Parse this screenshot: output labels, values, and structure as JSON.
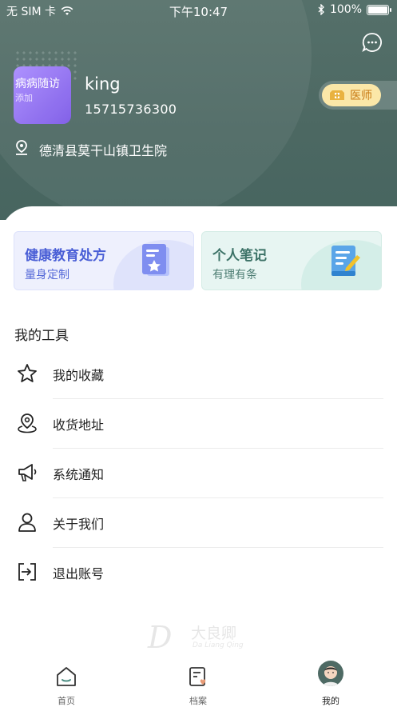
{
  "status_bar": {
    "carrier": "无 SIM 卡",
    "time": "下午10:47",
    "battery": "100%"
  },
  "profile": {
    "avatar_line1": "病病随访",
    "avatar_line2": "添加",
    "name": "king",
    "phone": "15715736300",
    "badge": "医师",
    "hospital": "德清县莫干山镇卫生院"
  },
  "cards": [
    {
      "title": "健康教育处方",
      "subtitle": "量身定制"
    },
    {
      "title": "个人笔记",
      "subtitle": "有理有条"
    }
  ],
  "tools": {
    "title": "我的工具",
    "items": [
      {
        "label": "我的收藏",
        "icon": "star-icon"
      },
      {
        "label": "收货地址",
        "icon": "location-icon"
      },
      {
        "label": "系统通知",
        "icon": "megaphone-icon"
      },
      {
        "label": "关于我们",
        "icon": "person-icon"
      },
      {
        "label": "退出账号",
        "icon": "logout-icon"
      }
    ]
  },
  "logo": {
    "cn": "大良卿",
    "en": "Da Liang Qing"
  },
  "tabbar": {
    "items": [
      {
        "label": "首页"
      },
      {
        "label": "档案"
      },
      {
        "label": "我的"
      }
    ],
    "active": 2
  },
  "colors": {
    "header": "#4c6862",
    "blue_accent": "#4a5fd6",
    "green_accent": "#3c7267",
    "badge": "#fbe7a8"
  }
}
